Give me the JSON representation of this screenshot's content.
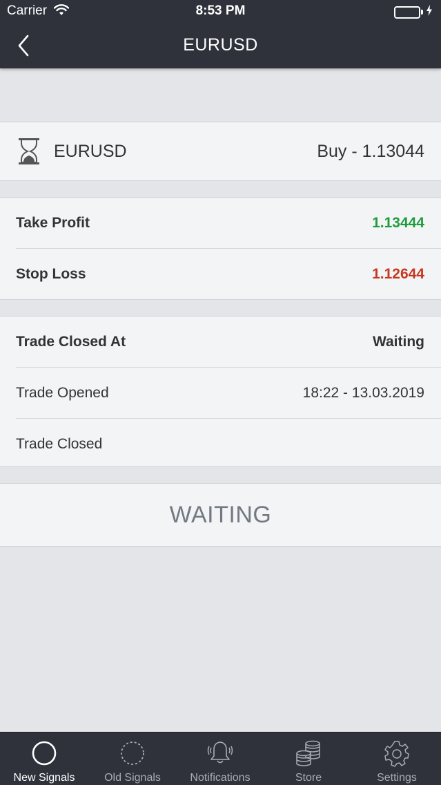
{
  "status_bar": {
    "carrier": "Carrier",
    "time": "8:53 PM"
  },
  "nav": {
    "title": "EURUSD"
  },
  "signal": {
    "symbol": "EURUSD",
    "direction_price": "Buy - 1.13044"
  },
  "levels": {
    "take_profit_label": "Take Profit",
    "take_profit_value": "1.13444",
    "stop_loss_label": "Stop Loss",
    "stop_loss_value": "1.12644"
  },
  "trade_times": {
    "closed_at_label": "Trade Closed At",
    "closed_at_value": "Waiting",
    "opened_label": "Trade Opened",
    "opened_value": "18:22 - 13.03.2019",
    "closed_label": "Trade Closed",
    "closed_value": ""
  },
  "status": {
    "text": "WAITING"
  },
  "tabs": [
    {
      "label": "New Signals",
      "icon": "circle-icon",
      "active": true
    },
    {
      "label": "Old Signals",
      "icon": "dashed-circle-icon",
      "active": false
    },
    {
      "label": "Notifications",
      "icon": "bell-icon",
      "active": false
    },
    {
      "label": "Store",
      "icon": "coins-icon",
      "active": false
    },
    {
      "label": "Settings",
      "icon": "gear-icon",
      "active": false
    }
  ],
  "colors": {
    "header_bg": "#2f323b",
    "take_profit": "#1e9c3b",
    "stop_loss": "#c7371f",
    "battery": "#4cd964"
  }
}
